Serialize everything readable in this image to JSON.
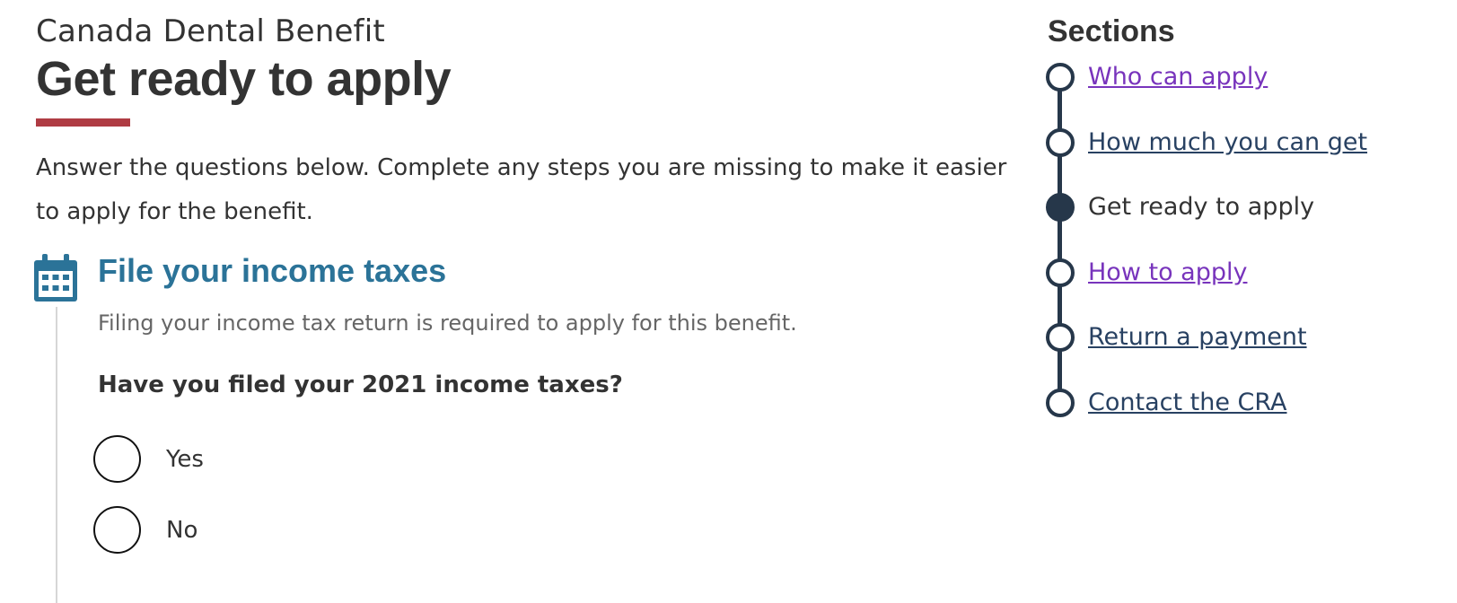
{
  "header": {
    "subtitle": "Canada Dental Benefit",
    "title": "Get ready to apply"
  },
  "intro": "Answer the questions below. Complete any steps you are missing to make it easier to apply for the benefit.",
  "step": {
    "icon": "calendar-icon",
    "heading": "File your income taxes",
    "description": "Filing your income tax return is required to apply for this benefit.",
    "question": "Have you filed your 2021 income taxes?",
    "options": [
      {
        "label": "Yes",
        "selected": false
      },
      {
        "label": "No",
        "selected": false
      }
    ]
  },
  "sidebar": {
    "title": "Sections",
    "items": [
      {
        "label": "Who can apply",
        "state": "visited"
      },
      {
        "label": "How much you can get",
        "state": "link"
      },
      {
        "label": "Get ready to apply",
        "state": "current"
      },
      {
        "label": "How to apply",
        "state": "visited"
      },
      {
        "label": "Return a payment",
        "state": "link"
      },
      {
        "label": "Contact the CRA",
        "state": "link"
      }
    ]
  },
  "colors": {
    "accent_rule": "#af3c43",
    "heading_blue": "#2b7398",
    "stepper": "#26374a",
    "link": "#284162",
    "visited_link": "#7834bc"
  }
}
